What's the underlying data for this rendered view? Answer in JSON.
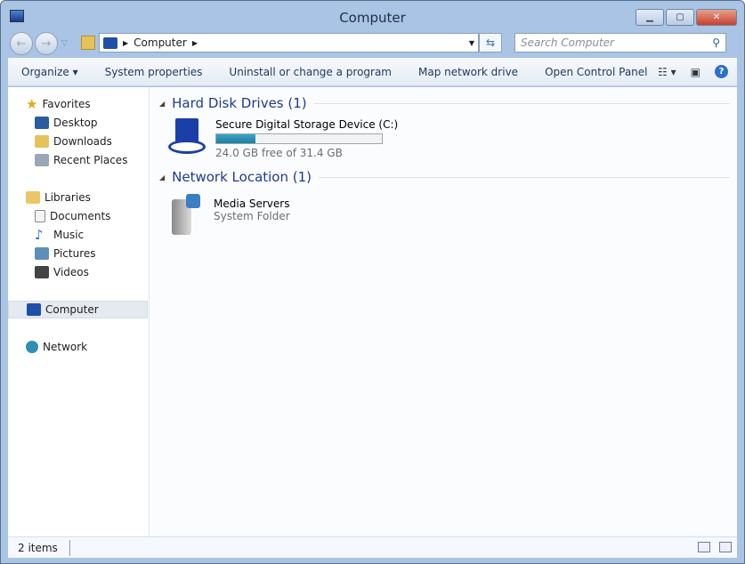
{
  "window": {
    "title": "Computer"
  },
  "address": {
    "crumbs": [
      "Computer"
    ],
    "search_placeholder": "Search Computer"
  },
  "toolbar": {
    "organize": "Organize",
    "system_properties": "System properties",
    "uninstall": "Uninstall or change a program",
    "map_drive": "Map network drive",
    "control_panel": "Open Control Panel"
  },
  "sidebar": {
    "favorites": "Favorites",
    "fav_items": [
      "Desktop",
      "Downloads",
      "Recent Places"
    ],
    "libraries": "Libraries",
    "lib_items": [
      "Documents",
      "Music",
      "Pictures",
      "Videos"
    ],
    "computer": "Computer",
    "network": "Network"
  },
  "groups": {
    "hdd": {
      "title": "Hard Disk Drives (1)",
      "drive": {
        "name": "Secure Digital Storage Device (C:)",
        "free": "24.0 GB free of 31.4 GB",
        "used_fraction": 0.236,
        "bar_color": "#1d7e9e"
      }
    },
    "net": {
      "title": "Network Location (1)",
      "item": {
        "name": "Media Servers",
        "type": "System Folder"
      }
    }
  },
  "status": {
    "count": "2 items"
  }
}
